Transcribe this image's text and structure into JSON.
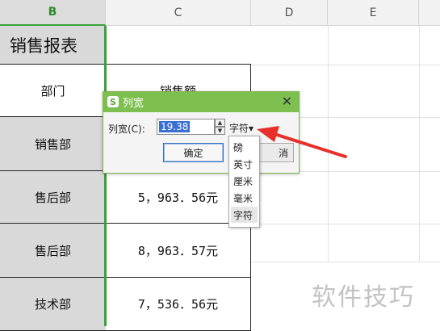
{
  "columns": {
    "b": "B",
    "c": "C",
    "d": "D",
    "e": "E"
  },
  "sheet": {
    "title": "销售报表",
    "header_dept": "部门",
    "header_sales_partial": "销售额",
    "rows": [
      {
        "dept": "销售部",
        "amount": ""
      },
      {
        "dept": "售后部",
        "amount": "5，963．56元"
      },
      {
        "dept": "售后部",
        "amount": "8，963．57元"
      },
      {
        "dept": "技术部",
        "amount": "7，536．56元"
      }
    ]
  },
  "dialog": {
    "logo": "S",
    "title": "列宽",
    "close": "✕",
    "label": "列宽(C):",
    "value": "19.38",
    "spin_up": "▲",
    "spin_down": "▼",
    "unit": "字符▾",
    "ok": "确定",
    "cancel_partial": "消"
  },
  "unit_dropdown": {
    "options": [
      "磅",
      "英寸",
      "厘米",
      "毫米",
      "字符"
    ],
    "selected": "字符"
  },
  "annotation": {
    "arrow_color": "#e8302a"
  },
  "watermark": "软件技巧",
  "colors": {
    "accent": "#7ec04f",
    "selection": "#3ba03b",
    "gray_fill": "#d9d9d9"
  }
}
